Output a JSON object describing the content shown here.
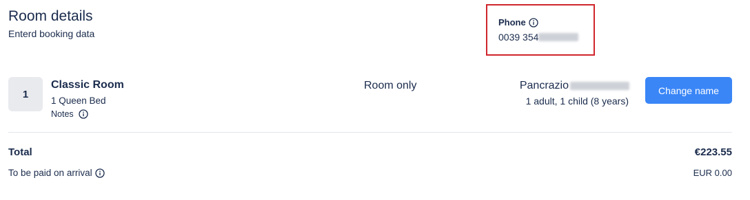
{
  "header": {
    "title": "Room details",
    "subtitle": "Enterd booking data"
  },
  "phone": {
    "label": "Phone",
    "value_visible": "0039 354",
    "info_icon": "info-circle-icon",
    "highlight_color": "#d0242c"
  },
  "room": {
    "number": "1",
    "name": "Classic Room",
    "bed": "1 Queen Bed",
    "notes_label": "Notes",
    "meal_plan": "Room only",
    "guest_first_name": "Pancrazio",
    "occupancy": "1 adult, 1 child (8 years)",
    "change_name_label": "Change name",
    "button_color": "#3a86f7"
  },
  "summary": {
    "total_label": "Total",
    "total_value": "€223.55",
    "arrival_label": "To be paid on arrival",
    "arrival_value": "EUR 0.00"
  }
}
